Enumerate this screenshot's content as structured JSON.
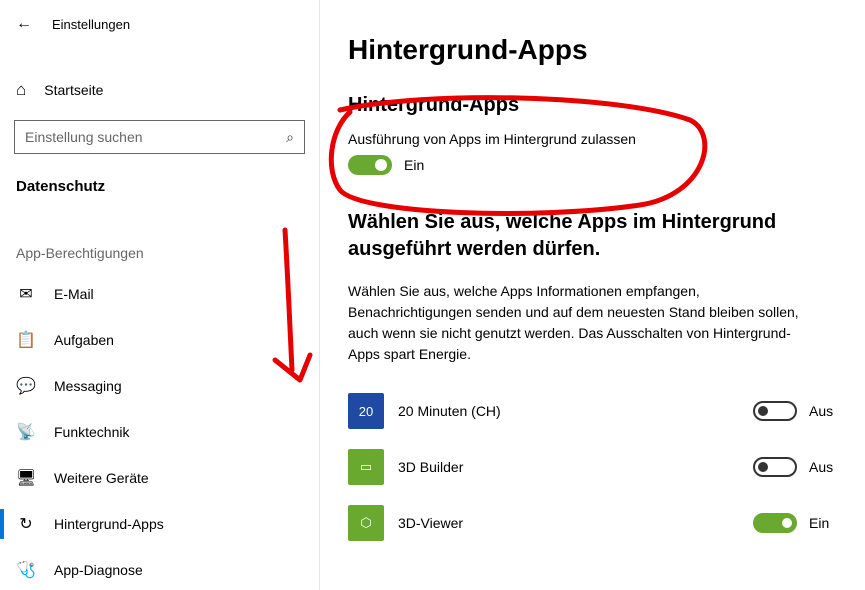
{
  "window": {
    "title": "Einstellungen"
  },
  "sidebar": {
    "home_label": "Startseite",
    "search_placeholder": "Einstellung suchen",
    "section_title": "Datenschutz",
    "group_title": "App-Berechtigungen",
    "items": [
      {
        "icon": "✉",
        "label": "E-Mail"
      },
      {
        "icon": "📋",
        "label": "Aufgaben"
      },
      {
        "icon": "💬",
        "label": "Messaging"
      },
      {
        "icon": "📡",
        "label": "Funktechnik"
      },
      {
        "icon": "🖥",
        "label": "Weitere Geräte"
      },
      {
        "icon": "↻",
        "label": "Hintergrund-Apps"
      },
      {
        "icon": "🩺",
        "label": "App-Diagnose"
      }
    ],
    "active_index": 5
  },
  "main": {
    "page_title": "Hintergrund-Apps",
    "section_heading": "Hintergrund-Apps",
    "allow_label": "Ausführung von Apps im Hintergrund zulassen",
    "master_toggle_state": "Ein",
    "choose_title": "Wählen Sie aus, welche Apps im Hintergrund ausgeführt werden dürfen.",
    "choose_desc": "Wählen Sie aus, welche Apps Informationen empfangen, Benachrichtigungen senden und auf dem neuesten Stand bleiben sollen, auch wenn sie nicht genutzt werden. Das Ausschalten von Hintergrund-Apps spart Energie.",
    "apps": [
      {
        "name": "20 Minuten (CH)",
        "state": "Aus",
        "on": false,
        "color": "#1f4aa3",
        "glyph": "20"
      },
      {
        "name": "3D Builder",
        "state": "Aus",
        "on": false,
        "color": "#6aa92f",
        "glyph": "▭"
      },
      {
        "name": "3D-Viewer",
        "state": "Ein",
        "on": true,
        "color": "#6aa92f",
        "glyph": "⬡"
      }
    ]
  }
}
